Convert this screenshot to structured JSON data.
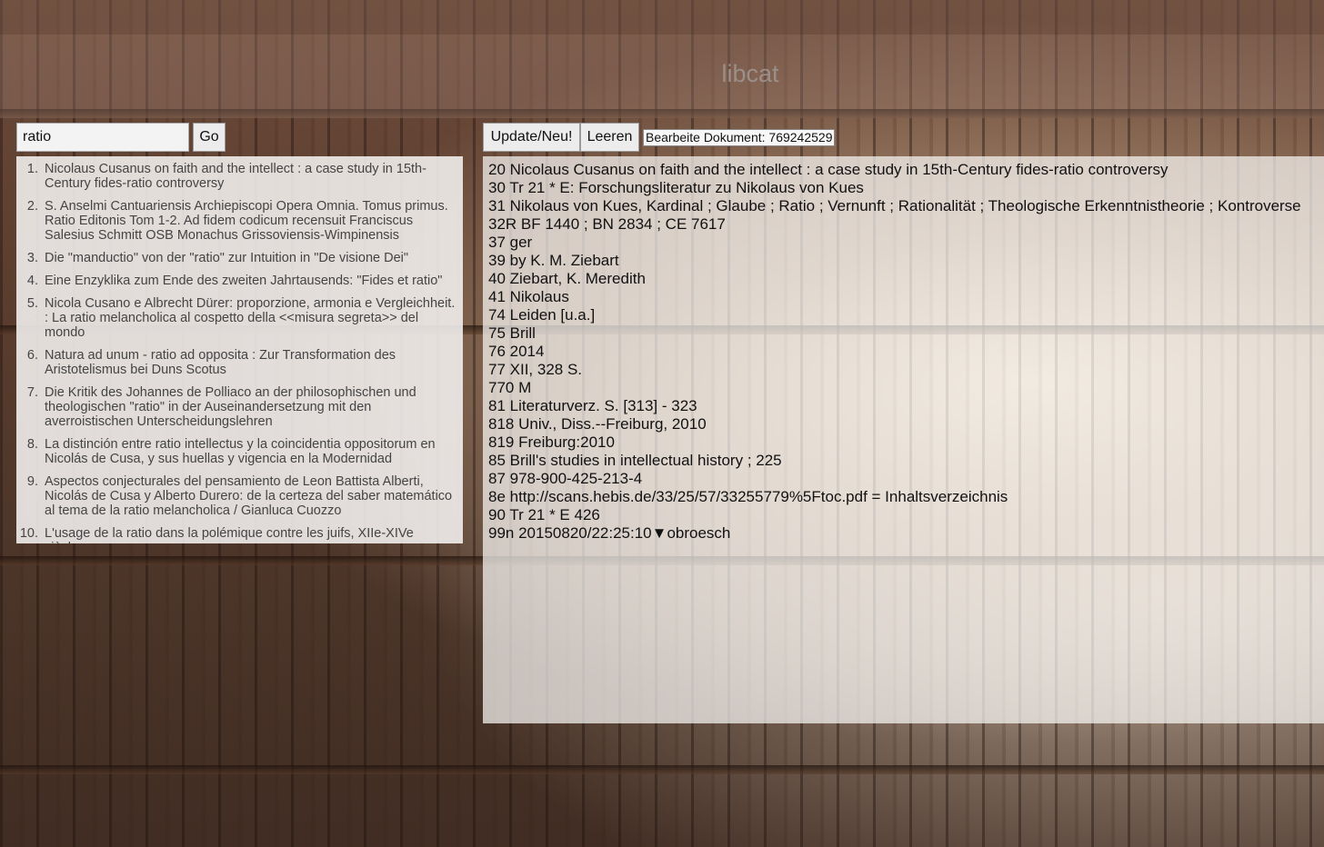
{
  "app": {
    "title": "libcat"
  },
  "search": {
    "value": "ratio",
    "go_label": "Go"
  },
  "toolbar": {
    "update_label": "Update/Neu!",
    "clear_label": "Leeren",
    "doc_label": "Bearbeite Dokument: 769242529"
  },
  "results": [
    {
      "num": "1.",
      "title": "Nicolaus Cusanus on faith and the intellect : a case study in 15th-Century fides-ratio controversy"
    },
    {
      "num": "2.",
      "title": "S. Anselmi Cantuariensis Archiepiscopi Opera Omnia. Tomus primus. Ratio Editonis Tom 1-2. Ad fidem codicum recensuit Franciscus Salesius Schmitt OSB Monachus Grissoviensis-Wimpinensis"
    },
    {
      "num": "3.",
      "title": "Die \"manductio\" von der \"ratio\" zur Intuition in \"De visione Dei\""
    },
    {
      "num": "4.",
      "title": "Eine Enzyklika zum Ende des zweiten Jahrtausends: \"Fides et ratio\""
    },
    {
      "num": "5.",
      "title": "Nicola Cusano e Albrecht Dürer: proporzione, armonia e Vergleichheit. : La ratio melancholica al cospetto della <<misura segreta>> del mondo"
    },
    {
      "num": "6.",
      "title": "Natura ad unum - ratio ad opposita : Zur Transformation des Aristotelismus bei Duns Scotus"
    },
    {
      "num": "7.",
      "title": "Die Kritik des Johannes de Polliaco an der philosophischen und theologischen \"ratio\" in der Auseinandersetzung mit den averroistischen Unterscheidungslehren"
    },
    {
      "num": "8.",
      "title": "La distinción entre ratio intellectus y la coincidentia oppositorum en Nicolás de Cusa, y sus huellas y vigencia en la Modernidad"
    },
    {
      "num": "9.",
      "title": "Aspectos conjecturales del pensamiento de Leon Battista Alberti, Nicolás de Cusa y Alberto Durero: de la certeza del saber matemático al tema de la ratio melancholica / Gianluca Cuozzo"
    },
    {
      "num": "10.",
      "title": "L'usage de la ratio dans la polémique contre les juifs, XIIe-XIVe siècles"
    }
  ],
  "record": [
    "20 Nicolaus Cusanus on faith and the intellect : a case study in 15th-Century fides-ratio controversy",
    "30 Tr 21 * E: Forschungsliteratur zu Nikolaus von Kues",
    "31 Nikolaus von Kues, Kardinal ; Glaube ; Ratio ; Vernunft ; Rationalität ; Theologische Erkenntnistheorie ; Kontroverse",
    "32R BF 1440 ; BN 2834 ; CE 7617",
    "37 ger",
    "39 by K. M. Ziebart",
    "40 Ziebart, K. Meredith",
    "41 Nikolaus",
    "74 Leiden [u.a.]",
    "75 Brill",
    "76 2014",
    "77 XII, 328 S.",
    "770 M",
    "81 Literaturverz. S. [313] - 323",
    "818 Univ., Diss.--Freiburg, 2010",
    "819 Freiburg:2010",
    "85 Brill's studies in intellectual history ; 225",
    "87 978-900-425-213-4",
    "8e http://scans.hebis.de/33/25/57/33255779%5Ftoc.pdf = Inhaltsverzeichnis",
    "90 Tr 21 * E 426",
    "99n 20150820/22:25:10▼obroesch"
  ]
}
